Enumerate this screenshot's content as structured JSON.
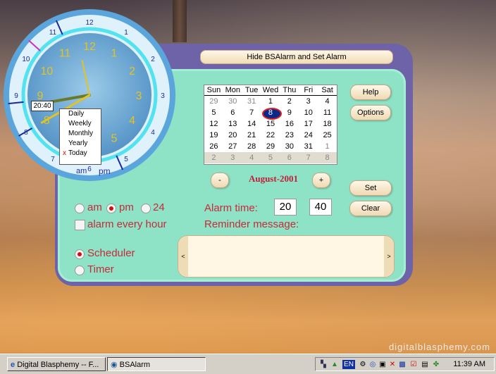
{
  "app": {
    "hide_button": "Hide BSAlarm and Set Alarm",
    "help": "Help",
    "options": "Options",
    "set": "Set",
    "clear": "Clear",
    "prev": "-",
    "next": "+",
    "month_year": "August-2001"
  },
  "calendar": {
    "days": [
      "Sun",
      "Mon",
      "Tue",
      "Wed",
      "Thu",
      "Fri",
      "Sat"
    ],
    "rows": [
      [
        "29",
        "30",
        "31",
        "1",
        "2",
        "3",
        "4"
      ],
      [
        "5",
        "6",
        "7",
        "8",
        "9",
        "10",
        "11"
      ],
      [
        "12",
        "13",
        "14",
        "15",
        "16",
        "17",
        "18"
      ],
      [
        "19",
        "20",
        "21",
        "22",
        "23",
        "24",
        "25"
      ],
      [
        "26",
        "27",
        "28",
        "29",
        "30",
        "31",
        "1"
      ],
      [
        "2",
        "3",
        "4",
        "5",
        "6",
        "7",
        "8"
      ]
    ],
    "selected": "8"
  },
  "mode": {
    "am": "am",
    "pm": "pm",
    "h24": "24",
    "selected": "pm"
  },
  "alarm_every_hour": "alarm  every  hour",
  "alarm_time": {
    "label": "Alarm  time:",
    "hour": "20",
    "minute": "40"
  },
  "reminder_label": "Reminder  message:",
  "scheduler": "Scheduler",
  "timer": "Timer",
  "msg_left": "<",
  "msg_right": ">",
  "clock": {
    "digital": "20:40",
    "numbers_outer": [
      "12",
      "1",
      "2",
      "3",
      "4",
      "5",
      "6",
      "7",
      "8",
      "9",
      "10",
      "11"
    ],
    "numbers_inner": [
      "12",
      "1",
      "2",
      "3",
      "4",
      "5",
      "6",
      "7",
      "8",
      "9",
      "10",
      "11"
    ],
    "am_label": "am",
    "pm_label": "pm",
    "hour_hand_value": 8.67,
    "minute_hand_value": 40
  },
  "menu": [
    "Daily",
    "Weekly",
    "Monthly",
    "Yearly",
    "Today"
  ],
  "menu_checked": "Today",
  "menu_mark": "x",
  "watermark": "digitalblasphemy.com",
  "taskbar": {
    "items": [
      "Digital Blasphemy -- F...",
      "BSAlarm"
    ],
    "lang": "EN",
    "time": "11:39 AM"
  }
}
